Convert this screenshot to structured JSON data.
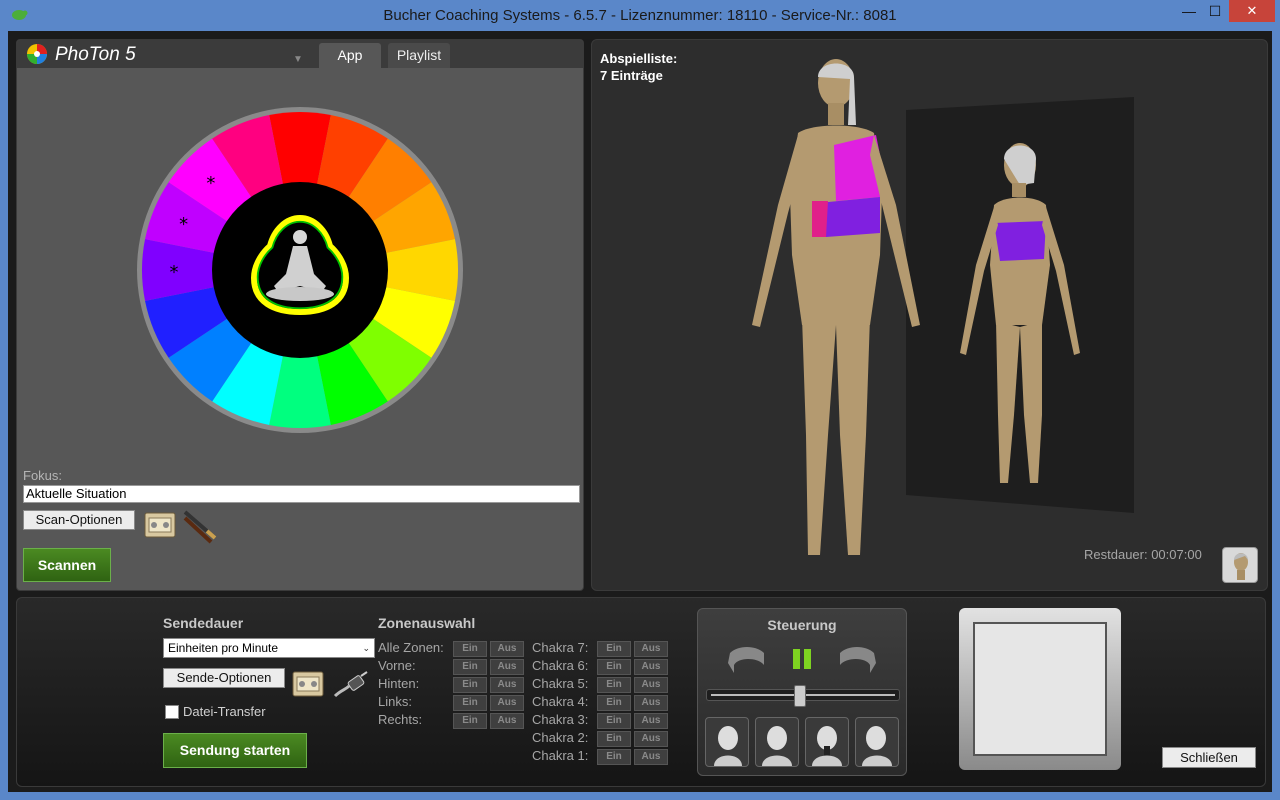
{
  "window": {
    "title": "Bucher Coaching Systems - 6.5.7 - Lizenznummer: 18110 - Service-Nr.: 8081",
    "min_glyph": "—",
    "max_glyph": "☐",
    "close_glyph": "✕"
  },
  "left": {
    "logo": "PhoTon 5",
    "tabs": [
      {
        "label": "App",
        "active": true
      },
      {
        "label": "Playlist",
        "active": false
      }
    ],
    "wheel": {
      "segment_colors": [
        "#ff0000",
        "#ff4000",
        "#ff7f00",
        "#ffa500",
        "#ffd700",
        "#ffff00",
        "#7fff00",
        "#00ff00",
        "#00ff7f",
        "#00ffff",
        "#0080ff",
        "#2020ff",
        "#8000ff",
        "#c000ff",
        "#ff00ff",
        "#ff0080"
      ],
      "marked_segments": [
        12,
        13,
        14
      ],
      "marker": "*"
    },
    "focus_label": "Fokus:",
    "focus_value": "Aktuelle Situation",
    "scan_options": "Scan-Optionen",
    "scan_button": "Scannen"
  },
  "right": {
    "playlist_title": "Abspielliste:",
    "playlist_count": "7 Einträge",
    "remaining": "Restdauer: 00:07:00"
  },
  "bottom": {
    "send_duration_title": "Sendedauer",
    "unit_select": "Einheiten pro Minute",
    "send_options": "Sende-Optionen",
    "file_transfer": "Datei-Transfer",
    "file_transfer_checked": false,
    "start_button": "Sendung starten",
    "zone_title": "Zonenauswahl",
    "zones": [
      "Alle Zonen:",
      "Vorne:",
      "Hinten:",
      "Links:",
      "Rechts:"
    ],
    "chakras": [
      "Chakra 7:",
      "Chakra 6:",
      "Chakra 5:",
      "Chakra 4:",
      "Chakra 3:",
      "Chakra 2:",
      "Chakra 1:"
    ],
    "on_label": "Ein",
    "off_label": "Aus",
    "control_title": "Steuerung",
    "slider_value": 0.48,
    "close_button": "Schließen"
  },
  "colors": {
    "title_bar": "#5a87c9",
    "accent_green": "#3d7a1a",
    "body_skin": "#b49a70",
    "highlight_magenta": "#e020e0",
    "highlight_purple": "#8020e0"
  }
}
